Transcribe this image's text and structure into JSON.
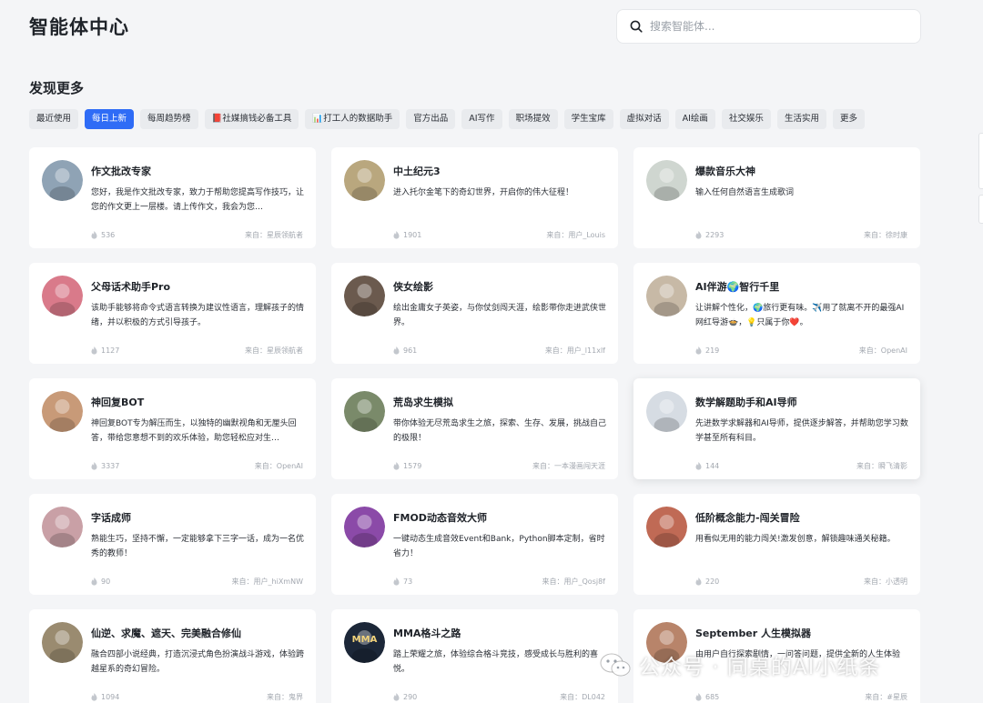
{
  "header": {
    "title": "智能体中心",
    "search_placeholder": "搜索智能体..."
  },
  "section_title": "发现更多",
  "tabs": [
    {
      "label": "最近使用"
    },
    {
      "label": "每日上新",
      "active": true
    },
    {
      "label": "每周趋势榜"
    },
    {
      "label": "📕社媒搞钱必备工具"
    },
    {
      "label": "📊打工人的数据助手"
    },
    {
      "label": "官方出品"
    },
    {
      "label": "AI写作"
    },
    {
      "label": "职场提效"
    },
    {
      "label": "学生宝库"
    },
    {
      "label": "虚拟对话"
    },
    {
      "label": "AI绘画"
    },
    {
      "label": "社交娱乐"
    },
    {
      "label": "生活实用"
    },
    {
      "label": "更多"
    }
  ],
  "cards": [
    {
      "name": "作文批改专家",
      "desc": "您好，我是作文批改专家，致力于帮助您提高写作技巧，让您的作文更上一层楼。请上传作文，我会为您…",
      "count": "536",
      "source": "来自：星辰领航者",
      "avatar_color": "#8fa3b5"
    },
    {
      "name": "中土纪元3",
      "desc": "进入托尔金笔下的奇幻世界，开启你的伟大征程！",
      "count": "1901",
      "source": "来自：用户_Louis",
      "avatar_color": "#b9a77e"
    },
    {
      "name": "爆款音乐大神",
      "desc": "输入任何自然语言生成歌词",
      "count": "2293",
      "source": "来自：徐时康",
      "avatar_color": "#cfd6d0"
    },
    {
      "name": "父母话术助手Pro",
      "desc": "该助手能够将命令式语言转换为建议性语言，理解孩子的情绪，并以积极的方式引导孩子。",
      "count": "1127",
      "source": "来自：星辰领航者",
      "avatar_color": "#d97a8a"
    },
    {
      "name": "侠女绘影",
      "desc": "绘出金庸女子英姿，与你仗剑闯天涯，绘影带你走进武侠世界。",
      "count": "961",
      "source": "来自：用户_l11xlf",
      "avatar_color": "#6b5a4e"
    },
    {
      "name": "AI伴游🌍智行千里",
      "desc": "让讲解个性化，🌍旅行更有味。✈️用了就离不开的最强AI网红导游🍲，💡只属于你❤️。",
      "count": "219",
      "source": "来自：OpenAI",
      "avatar_color": "#c7b9a6"
    },
    {
      "name": "神回复BOT",
      "desc": "神回复BOT专为解压而生，以独特的幽默视角和无厘头回答，带给您意想不到的欢乐体验，助您轻松应对生…",
      "count": "3337",
      "source": "来自：OpenAI",
      "avatar_color": "#c89a78"
    },
    {
      "name": "荒岛求生模拟",
      "desc": "带你体验无尽荒岛求生之旅，探索、生存、发展，挑战自己的极限！",
      "count": "1579",
      "source": "来自：一本漫画闯天涯",
      "avatar_color": "#7a8a6a"
    },
    {
      "name": "数学解题助手和AI导师",
      "desc": "先进数学求解器和AI导师，提供逐步解答，并帮助您学习数学甚至所有科目。",
      "count": "144",
      "source": "来自：瞬飞清影",
      "avatar_color": "#d6dce3",
      "hover": true
    },
    {
      "name": "字话成师",
      "desc": "熟能生巧，坚持不懈，一定能够拿下三字一话，成为一名优秀的教师！",
      "count": "90",
      "source": "来自：用户_hiXmNW",
      "avatar_color": "#c9a0a6"
    },
    {
      "name": "FMOD动态音效大师",
      "desc": "一键动态生成音效Event和Bank，Python脚本定制，省时省力！",
      "count": "73",
      "source": "来自：用户_Qosj8f",
      "avatar_color": "#8b4aa8"
    },
    {
      "name": "低阶概念能力-闯关冒险",
      "desc": "用看似无用的能力闯关!激发创意，解锁趣味通关秘籍。",
      "count": "220",
      "source": "来自：小透明",
      "avatar_color": "#c06a55"
    },
    {
      "name": "仙逆、求魔、遮天、完美融合修仙",
      "desc": "融合四部小说经典，打造沉浸式角色扮演战斗游戏，体验跨越星系的奇幻冒险。",
      "count": "1094",
      "source": "来自：鬼界",
      "avatar_color": "#9a8b70"
    },
    {
      "name": "MMA格斗之路",
      "desc": "踏上荣耀之旅，体验综合格斗竞技，感受成长与胜利的喜悦。",
      "count": "290",
      "source": "来自：DL042",
      "avatar_color": "#1c2738",
      "avatar_text": "MMA"
    },
    {
      "name": "September 人生模拟器",
      "desc": "由用户自行探索剧情，一问答问题，提供全新的人生体验",
      "count": "685",
      "source": "来自：#星辰",
      "avatar_color": "#b8846a"
    }
  ],
  "watermark": "公众号 · 同桌的AI小纸条",
  "icons": {
    "search": "search-icon",
    "count": "flame-icon",
    "watermark": "wechat-icon"
  }
}
